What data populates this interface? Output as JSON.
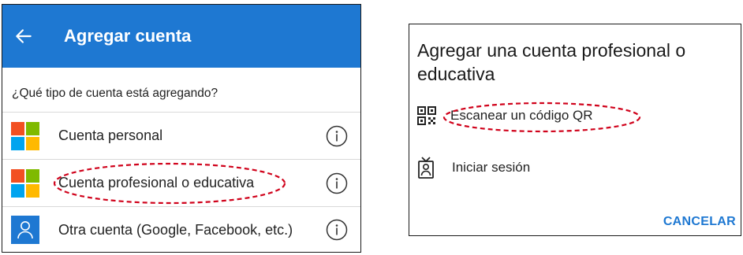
{
  "left": {
    "appbar": {
      "title": "Agregar cuenta",
      "icon": "arrow-left-icon",
      "color": "#1e78d2"
    },
    "prompt": "¿Qué tipo de cuenta está agregando?",
    "rows": [
      {
        "label": "Cuenta personal",
        "icon": "microsoft-logo-icon"
      },
      {
        "label": "Cuenta profesional o educativa",
        "icon": "microsoft-logo-icon"
      },
      {
        "label": "Otra cuenta (Google, Facebook, etc.)",
        "icon": "person-icon"
      }
    ],
    "info_icon": "info-circle-icon"
  },
  "right": {
    "title": "Agregar una cuenta profesional o educativa",
    "options": [
      {
        "label": "Escanear un código QR",
        "icon": "qr-code-icon"
      },
      {
        "label": "Iniciar sesión",
        "icon": "badge-person-icon"
      }
    ],
    "cancel": "CANCELAR",
    "accent": "#1e78d2"
  },
  "annotations": {
    "color": "#d0021b"
  }
}
